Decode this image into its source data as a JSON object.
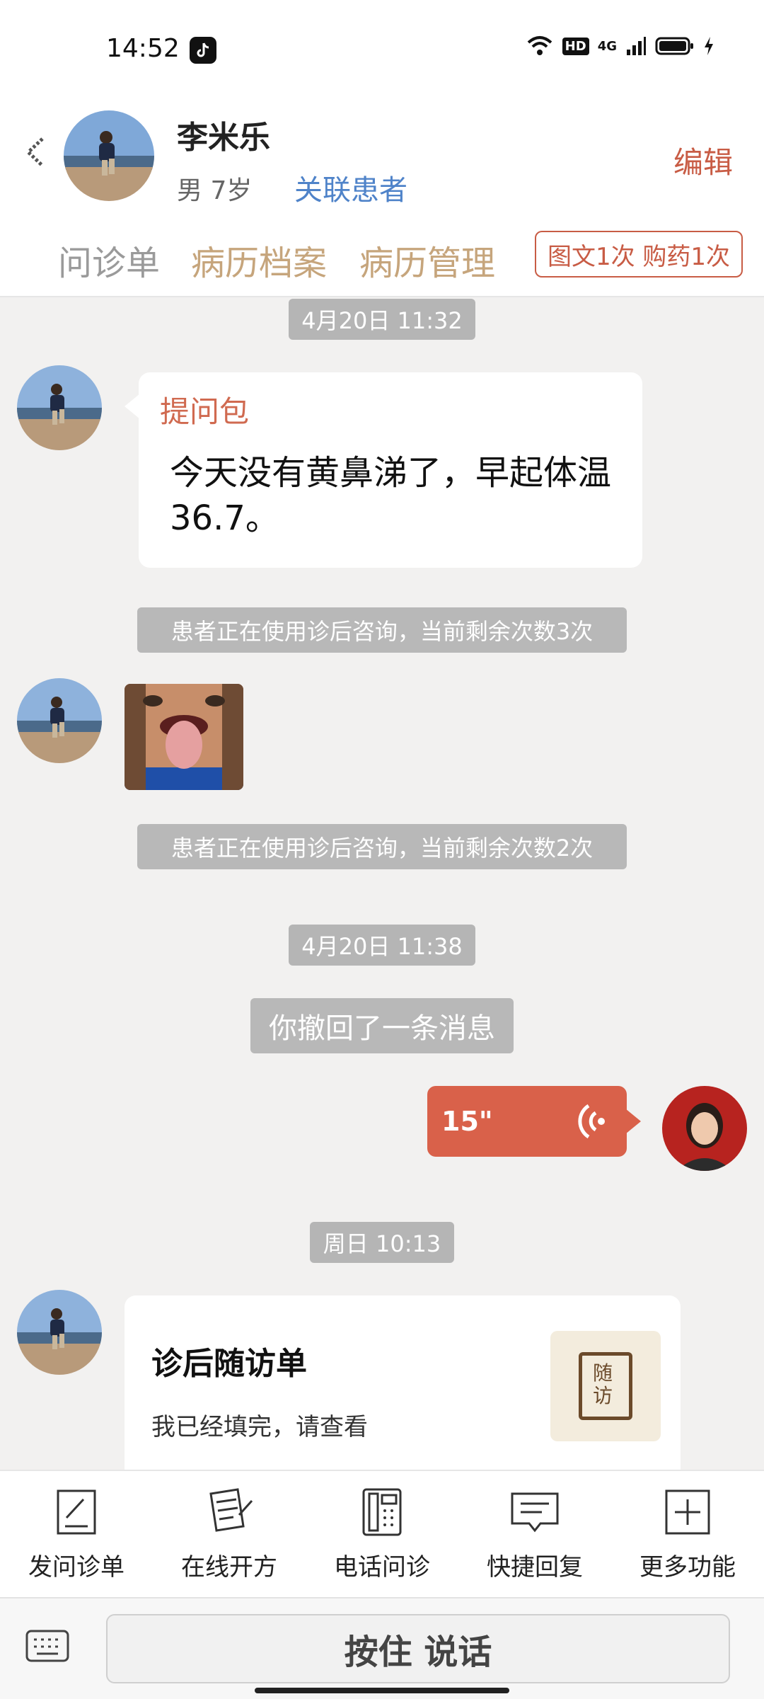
{
  "status_bar": {
    "time": "14:52",
    "network": "4G",
    "hd": "HD"
  },
  "header": {
    "patient_name": "李米乐",
    "patient_info": "男 7岁",
    "related_link": "关联患者",
    "edit_label": "编辑",
    "tabs": [
      {
        "label": "问诊单"
      },
      {
        "label": "病历档案"
      },
      {
        "label": "病历管理"
      }
    ],
    "quota_badge": "图文1次 购药1次"
  },
  "chat": {
    "time_1": "4月20日 11:32",
    "question_pack": {
      "title": "提问包",
      "text": "今天没有黄鼻涕了，早起体温36.7。"
    },
    "system_1": "患者正在使用诊后咨询，当前剩余次数3次",
    "system_2": "患者正在使用诊后咨询，当前剩余次数2次",
    "time_2": "4月20日 11:38",
    "recalled": "你撤回了一条消息",
    "voice": {
      "duration": "15\""
    },
    "time_3": "周日 10:13",
    "followup_card": {
      "title": "诊后随访单",
      "subtitle": "我已经填完，请查看",
      "icon_text": "随访"
    }
  },
  "toolbar": {
    "items": [
      {
        "label": "发问诊单",
        "icon": "form-pen-icon"
      },
      {
        "label": "在线开方",
        "icon": "prescription-icon"
      },
      {
        "label": "电话问诊",
        "icon": "phone-icon"
      },
      {
        "label": "快捷回复",
        "icon": "quick-reply-icon"
      },
      {
        "label": "更多功能",
        "icon": "plus-icon"
      }
    ]
  },
  "input": {
    "talk_button": "按住 说话"
  },
  "colors": {
    "accent": "#d9614a",
    "tan": "#c6a57c",
    "link": "#4f83c9"
  }
}
